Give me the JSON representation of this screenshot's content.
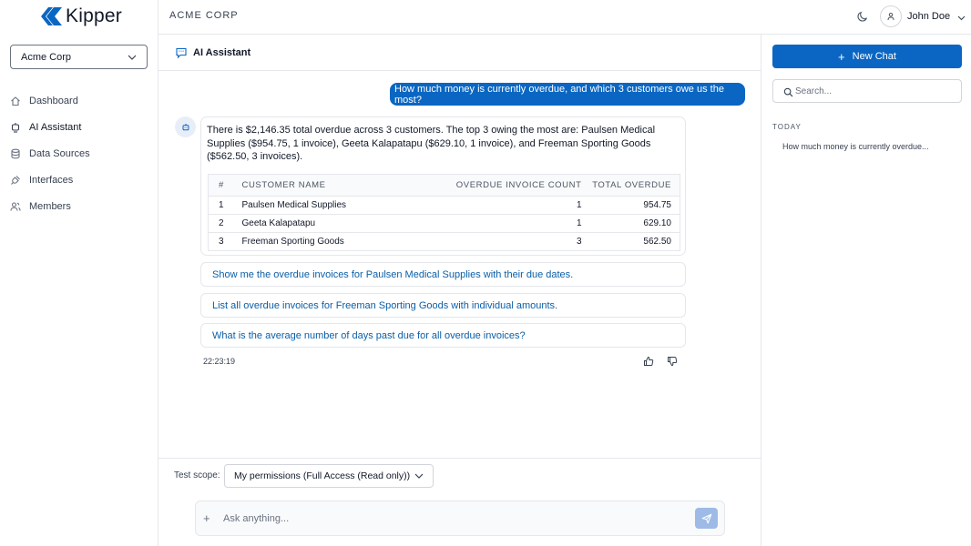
{
  "brand": {
    "name": "Kipper"
  },
  "org_selector": {
    "value": "Acme Corp"
  },
  "nav": {
    "items": [
      {
        "label": "Dashboard",
        "icon": "home-icon"
      },
      {
        "label": "AI Assistant",
        "icon": "robot-icon"
      },
      {
        "label": "Data Sources",
        "icon": "database-icon"
      },
      {
        "label": "Interfaces",
        "icon": "plug-icon"
      },
      {
        "label": "Members",
        "icon": "users-icon"
      }
    ]
  },
  "topbar": {
    "title": "ACME CORP",
    "user_name": "John Doe"
  },
  "chat": {
    "header_title": "AI Assistant",
    "user_message": "How much money is currently overdue, and which 3 customers owe us the most?",
    "bot_message": "There is $2,146.35 total overdue across 3 customers. The top 3 owing the most are: Paulsen Medical Supplies ($954.75, 1 invoice), Geeta Kalapatapu ($629.10, 1 invoice), and Freeman Sporting Goods ($562.50, 3 invoices).",
    "table": {
      "headers": [
        "#",
        "CUSTOMER NAME",
        "OVERDUE INVOICE COUNT",
        "TOTAL OVERDUE"
      ],
      "rows": [
        [
          "1",
          "Paulsen Medical Supplies",
          "1",
          "954.75"
        ],
        [
          "2",
          "Geeta Kalapatapu",
          "1",
          "629.10"
        ],
        [
          "3",
          "Freeman Sporting Goods",
          "3",
          "562.50"
        ]
      ]
    },
    "suggestions": [
      "Show me the overdue invoices for Paulsen Medical Supplies with their due dates.",
      "List all overdue invoices for Freeman Sporting Goods with individual amounts.",
      "What is the average number of days past due for all overdue invoices?"
    ],
    "timestamp": "22:23:19"
  },
  "composer": {
    "scope_label": "Test scope:",
    "scope_value": "My permissions (Full Access (Read only))",
    "placeholder": "Ask anything..."
  },
  "right_panel": {
    "new_chat_label": "New Chat",
    "search_placeholder": "Search...",
    "history_heading": "TODAY",
    "history_items": [
      "How much money is currently overdue..."
    ]
  },
  "colors": {
    "accent": "#0a66c2",
    "send_button": "#9dbbe6",
    "link": "#0a5ea8"
  }
}
